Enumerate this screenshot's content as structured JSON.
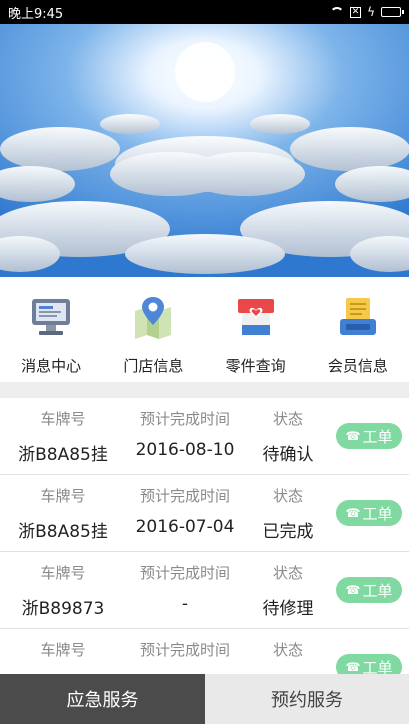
{
  "status_bar": {
    "time": "晚上9:45",
    "icons": [
      "wifi-icon",
      "x-box-icon",
      "charging-icon",
      "battery-icon"
    ]
  },
  "banner": {
    "image": "sky-with-clouds"
  },
  "quick_menu": [
    {
      "label": "消息中心",
      "icon": "message-center-icon"
    },
    {
      "label": "门店信息",
      "icon": "store-location-icon"
    },
    {
      "label": "零件查询",
      "icon": "parts-search-icon"
    },
    {
      "label": "会员信息",
      "icon": "member-info-icon"
    }
  ],
  "orders": {
    "headers": {
      "plate": "车牌号",
      "eta": "预计完成时间",
      "status": "状态"
    },
    "button_label": "工单",
    "button_color": "#7fd9a0",
    "rows": [
      {
        "plate": "浙B8A85挂",
        "eta": "2016-08-10",
        "status": "待确认"
      },
      {
        "plate": "浙B8A85挂",
        "eta": "2016-07-04",
        "status": "已完成"
      },
      {
        "plate": "浙B89873",
        "eta": "-",
        "status": "待修理"
      },
      {
        "plate": "",
        "eta": "",
        "status": ""
      }
    ]
  },
  "bottom_bar": {
    "emergency": "应急服务",
    "reserve": "预约服务"
  }
}
